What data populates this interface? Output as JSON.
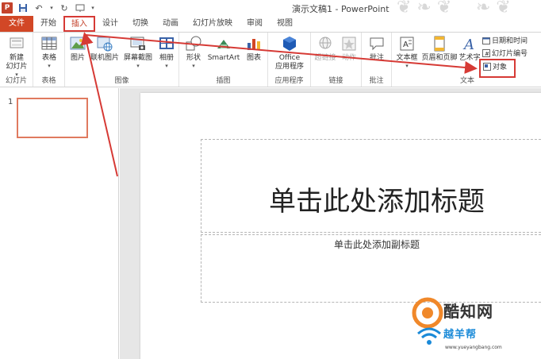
{
  "app": {
    "window_title": "演示文稿1 - PowerPoint",
    "icon_letter": "P"
  },
  "tabs": [
    {
      "label": "文件"
    },
    {
      "label": "开始"
    },
    {
      "label": "插入"
    },
    {
      "label": "设计"
    },
    {
      "label": "切换"
    },
    {
      "label": "动画"
    },
    {
      "label": "幻灯片放映"
    },
    {
      "label": "审阅"
    },
    {
      "label": "视图"
    }
  ],
  "ribbon": {
    "slides_group": {
      "label": "幻灯片",
      "new_slide": "新建\n幻灯片"
    },
    "tables_group": {
      "label": "表格",
      "table": "表格"
    },
    "images_group": {
      "label": "图像",
      "picture": "图片",
      "online_picture": "联机图片",
      "screenshot": "屏幕截图",
      "album": "相册"
    },
    "illustrations_group": {
      "label": "插图",
      "shapes": "形状",
      "smartart": "SmartArt",
      "chart": "图表"
    },
    "apps_group": {
      "label": "应用程序",
      "office_apps": "Office\n应用程序"
    },
    "links_group": {
      "label": "链接",
      "hyperlink": "超链接",
      "action": "动作"
    },
    "comments_group": {
      "label": "批注",
      "comment": "批注"
    },
    "text_group": {
      "label": "文本",
      "text_box": "文本框",
      "header_footer": "页眉和页脚",
      "wordart": "艺术字",
      "date_time": "日期和时间",
      "slide_number": "幻灯片编号",
      "object": "对象"
    }
  },
  "thumbnails": {
    "slide_number": "1"
  },
  "slide": {
    "title_placeholder": "单击此处添加标题",
    "subtitle_placeholder": "单击此处添加副标题"
  },
  "watermark": {
    "brand": "酷知网",
    "name": "越羊帮",
    "url": "www.yueyangbang.com"
  },
  "colors": {
    "accent": "#d24726",
    "annotation": "#d63a35"
  }
}
